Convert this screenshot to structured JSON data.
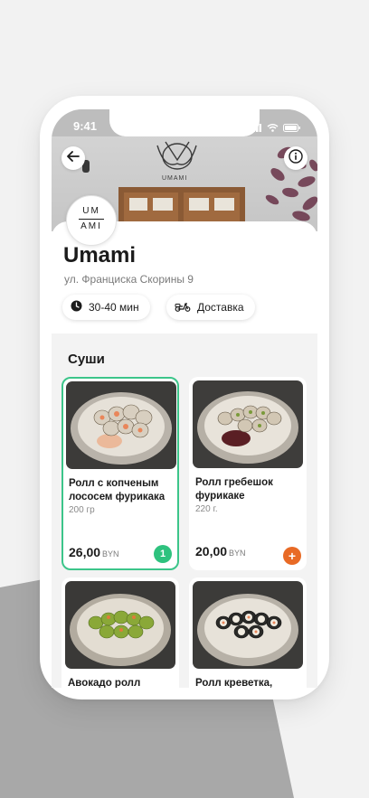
{
  "status": {
    "time": "9:41"
  },
  "restaurant": {
    "name": "Umami",
    "address": "ул. Франциска Скорины 9",
    "logo_text": [
      "UM",
      "AMI"
    ],
    "sign_text": "UMAMI"
  },
  "info_chips": [
    {
      "label": "30-40 мин",
      "icon": "clock-icon"
    },
    {
      "label": "Доставка",
      "icon": "scooter-icon"
    }
  ],
  "menu": {
    "section_title": "Суши",
    "items": [
      {
        "title": "Ролл с копченым лососем фурикака",
        "weight": "200 гр",
        "price": "26,00",
        "currency": "BYN",
        "quantity": "1",
        "selected": true
      },
      {
        "title": "Ролл гребешок фурикаке",
        "weight": "220 г.",
        "price": "20,00",
        "currency": "BYN",
        "add_icon": "+",
        "selected": false
      },
      {
        "title": "Авокадо ролл",
        "selected": false
      },
      {
        "title": "Ролл креветка,",
        "selected": false
      }
    ]
  },
  "colors": {
    "accent_green": "#2ec27e",
    "accent_orange": "#e86a25"
  }
}
